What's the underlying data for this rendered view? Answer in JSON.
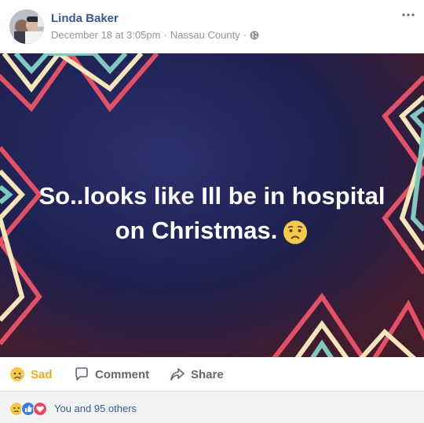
{
  "post": {
    "author": "Linda Baker",
    "timestamp": "December 18 at 3:05pm",
    "separator1": "·",
    "location": "Nassau County",
    "separator2": "·",
    "privacy_icon": "globe-icon",
    "text_line1": "So..looks like Ill be in hospital",
    "text_line2": "on Christmas.",
    "emoji": "sad-face-emoji",
    "background_colors": {
      "base": "#1d2150",
      "stripe_pink": "#e45066",
      "stripe_cream": "#f4e6b8",
      "stripe_teal": "#7fc9c0"
    }
  },
  "actions": {
    "reaction_label": "Sad",
    "comment_label": "Comment",
    "share_label": "Share",
    "reaction_color": "#e8ab22"
  },
  "reactions": {
    "summary": "You and 95 others",
    "icons": [
      "sad-reaction-icon",
      "like-reaction-icon",
      "love-reaction-icon"
    ]
  }
}
